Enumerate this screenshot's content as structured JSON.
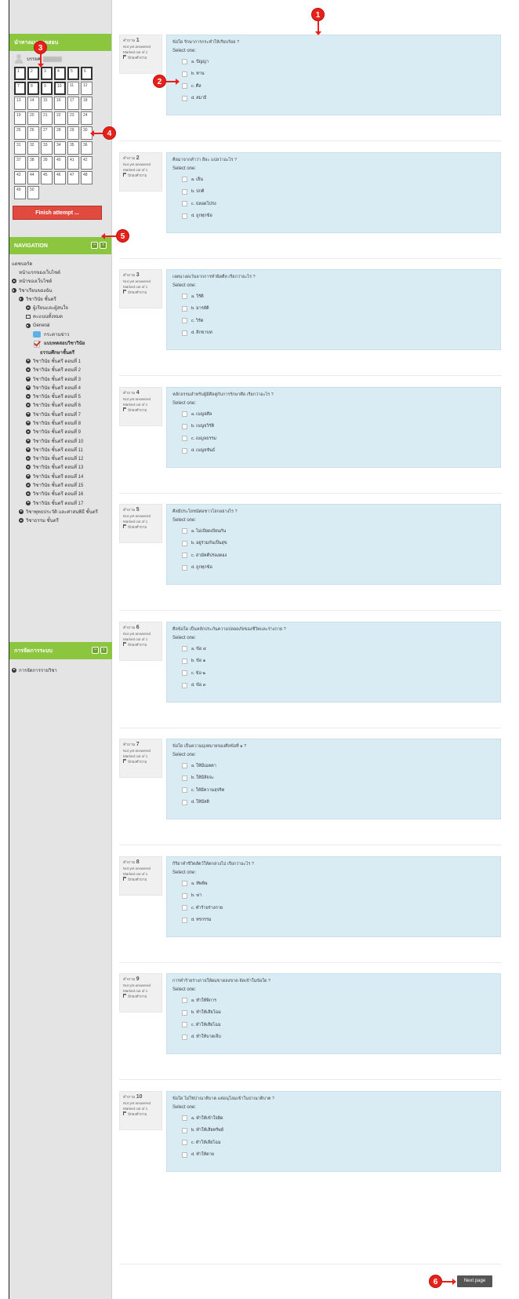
{
  "quiz_nav": {
    "title": "นำทางแบบทดสอบ",
    "user_label": "บรรยศ",
    "questions": [
      "1",
      "2",
      "3",
      "4",
      "5",
      "6",
      "7",
      "8",
      "9",
      "10",
      "11",
      "12",
      "13",
      "14",
      "15",
      "16",
      "17",
      "18",
      "19",
      "20",
      "21",
      "22",
      "23",
      "24",
      "25",
      "26",
      "27",
      "28",
      "29",
      "30",
      "31",
      "32",
      "33",
      "34",
      "35",
      "36",
      "37",
      "38",
      "39",
      "40",
      "41",
      "42",
      "43",
      "44",
      "45",
      "46",
      "47",
      "48",
      "49",
      "50"
    ],
    "current_page_questions": 10,
    "finish_label": "Finish attempt ..."
  },
  "navigation": {
    "title": "NAVIGATION",
    "items": [
      {
        "label": "แดชบอร์ด",
        "icon": "none",
        "indent": 0
      },
      {
        "label": "หน้าแรกของเว็บไซต์",
        "icon": "none",
        "indent": 1
      },
      {
        "label": "หน้าของเว็บไซต์",
        "icon": "bullet-right",
        "indent": 0
      },
      {
        "label": "วิชาเรียนของฉัน",
        "icon": "bullet-down",
        "indent": 0
      },
      {
        "label": "วิชาวินัย ชั้นตรี",
        "icon": "bullet-down",
        "indent": 1
      },
      {
        "label": "ผู้เรียนและผู้สนใจ",
        "icon": "bullet-right",
        "indent": 2
      },
      {
        "label": "คะแนนทั้งหมด",
        "icon": "grid",
        "indent": 2
      },
      {
        "label": "General",
        "icon": "bullet-down",
        "indent": 2
      },
      {
        "label": "กระดานข่าว",
        "icon": "chat",
        "indent": 3
      },
      {
        "label": "แบบทดสอบวิชาวินัย",
        "icon": "check",
        "indent": 3,
        "bold": true
      },
      {
        "label": "ธรรมศึกษาชั้นตรี",
        "icon": "none",
        "indent": 4,
        "bold": true
      },
      {
        "label": "วิชาวินัย ชั้นตรี ตอนที่ 1",
        "icon": "bullet-right",
        "indent": 2
      },
      {
        "label": "วิชาวินัย ชั้นตรี ตอนที่ 2",
        "icon": "bullet-right",
        "indent": 2
      },
      {
        "label": "วิชาวินัย ชั้นตรี ตอนที่ 3",
        "icon": "bullet-right",
        "indent": 2
      },
      {
        "label": "วิชาวินัย ชั้นตรี ตอนที่ 4",
        "icon": "bullet-right",
        "indent": 2
      },
      {
        "label": "วิชาวินัย ชั้นตรี ตอนที่ 5",
        "icon": "bullet-right",
        "indent": 2
      },
      {
        "label": "วิชาวินัย ชั้นตรี ตอนที่ 6",
        "icon": "bullet-right",
        "indent": 2
      },
      {
        "label": "วิชาวินัย ชั้นตรี ตอนที่ 7",
        "icon": "bullet-right",
        "indent": 2
      },
      {
        "label": "วิชาวินัย ชั้นตรี ตอนที่ 8",
        "icon": "bullet-right",
        "indent": 2
      },
      {
        "label": "วิชาวินัย ชั้นตรี ตอนที่ 9",
        "icon": "bullet-right",
        "indent": 2
      },
      {
        "label": "วิชาวินัย ชั้นตรี ตอนที่ 10",
        "icon": "bullet-right",
        "indent": 2
      },
      {
        "label": "วิชาวินัย ชั้นตรี ตอนที่ 11",
        "icon": "bullet-right",
        "indent": 2
      },
      {
        "label": "วิชาวินัย ชั้นตรี ตอนที่ 12",
        "icon": "bullet-right",
        "indent": 2
      },
      {
        "label": "วิชาวินัย ชั้นตรี ตอนที่ 13",
        "icon": "bullet-right",
        "indent": 2
      },
      {
        "label": "วิชาวินัย ชั้นตรี ตอนที่ 14",
        "icon": "bullet-right",
        "indent": 2
      },
      {
        "label": "วิชาวินัย ชั้นตรี ตอนที่ 15",
        "icon": "bullet-right",
        "indent": 2
      },
      {
        "label": "วิชาวินัย ชั้นตรี ตอนที่ 16",
        "icon": "bullet-right",
        "indent": 2
      },
      {
        "label": "วิชาวินัย ชั้นตรี ตอนที่ 17",
        "icon": "bullet-right",
        "indent": 2
      },
      {
        "label": "วิชาพุทธประวัติ และศาสนพิธี ชั้นตรี",
        "icon": "bullet-right",
        "indent": 1
      },
      {
        "label": "วิชาธรรม ชั้นตรี",
        "icon": "bullet-right",
        "indent": 1
      }
    ]
  },
  "administration": {
    "title": "การจัดการระบบ",
    "items": [
      {
        "label": "การจัดการรายวิชา"
      }
    ]
  },
  "question_meta": {
    "not_answered": "Not yet answered",
    "marked": "Marked out of 1",
    "flag": "ปักธงคำถาม",
    "select_one": "Select one:"
  },
  "questions": [
    {
      "label": "คำถาม",
      "num": "1",
      "text": "ข้อใด รักษาการกระทำให้เรียบร้อย ?",
      "options": [
        "a. ปัญญา",
        "b. ทาน",
        "c. ศีล",
        "d. สมาธิ"
      ]
    },
    {
      "label": "คำถาม",
      "num": "2",
      "text": "ศีลมาจากคำว่า สีละ แปลว่าอะไร ?",
      "options": [
        "a. เย็น",
        "b. ปกติ",
        "c. ปลอดโปร่ง",
        "d. ถูกทุกข้อ"
      ]
    },
    {
      "label": "คำถาม",
      "num": "3",
      "text": "เจตนางดเว้นจากการทำผิดศีล เรียกว่าอะไร ?",
      "options": [
        "a. วิรัติ",
        "b. มารยัติ",
        "c. วิรัต",
        "d. สิกขาบท"
      ]
    },
    {
      "label": "คำถาม",
      "num": "4",
      "text": "หลักธรรมสำหรับผู้มีศีลคู่กับการรักษาศีล เรียกว่าอะไร ?",
      "options": [
        "a. เบญจศีล",
        "b. เบญจวิรัติ",
        "c. เบญจธรรม",
        "d. เบญจขันธ์"
      ]
    },
    {
      "label": "คำถาม",
      "num": "5",
      "text": "ศีลมีประโยชน์ต่อชาวโลกอย่างไร ?",
      "options": [
        "a. ไม่เบียดเบียนกัน",
        "b. อยู่ร่วมกันเป็นสุข",
        "c. สามัคคีปรองดอง",
        "d. ถูกทุกข้อ"
      ]
    },
    {
      "label": "คำถาม",
      "num": "6",
      "text": "ศีลข้อใด เป็นหลักประกันความปลอดภัยของชีวิตและร่างกาย ?",
      "options": [
        "a. ข้อ ๔",
        "b. ข้อ ๑",
        "c. ข้อ ๒",
        "d. ข้อ ๓"
      ]
    },
    {
      "label": "คำถาม",
      "num": "7",
      "text": "ข้อใด เป็นความมุ่งหมายของศีลข้อที่ ๑ ?",
      "options": [
        "a. ให้มีเมตตา",
        "b. ให้มีสัจจะ",
        "c. ให้มีความสุจริต",
        "d. ให้มีสติ"
      ]
    },
    {
      "label": "คำถาม",
      "num": "8",
      "text": "กิริยาทำชีวิตสัตว์ให้ตกล่วงไป เรียกว่าอะไร ?",
      "options": [
        "a. ทัพพิษ",
        "b. ฆ่า",
        "c. ทำร้ายร่างกาย",
        "d. ทรกรรม"
      ]
    },
    {
      "label": "คำถาม",
      "num": "9",
      "text": "การทำร้ายร่างกายให้ผมขาดลงขาด จัดเข้าในข้อใด ?",
      "options": [
        "a. ทำให้พิการ",
        "b. ทำให้เสียโฉม",
        "c. ทำให้เสียโฉม",
        "d. ทำให้บาดเจ็บ"
      ]
    },
    {
      "label": "คำถาม",
      "num": "10",
      "text": "ข้อใด ไม่ใช่ปาณาติบาต แต่อนุโลมเข้าในปาณาติบาต ?",
      "options": [
        "a. ทำให้เข้าใจผิด",
        "b. ทำให้เสียทรัพย์",
        "c. ทำให้เสียโฉม",
        "d. ทำให้ตาย"
      ]
    }
  ],
  "next_page_label": "Next page",
  "annotations": [
    "1",
    "2",
    "3",
    "4",
    "5",
    "6"
  ],
  "colors": {
    "accent_green": "#8cc63f",
    "finish_red": "#e04a3f",
    "question_bg": "#d9ecf4",
    "marker_red": "#e8201a"
  }
}
